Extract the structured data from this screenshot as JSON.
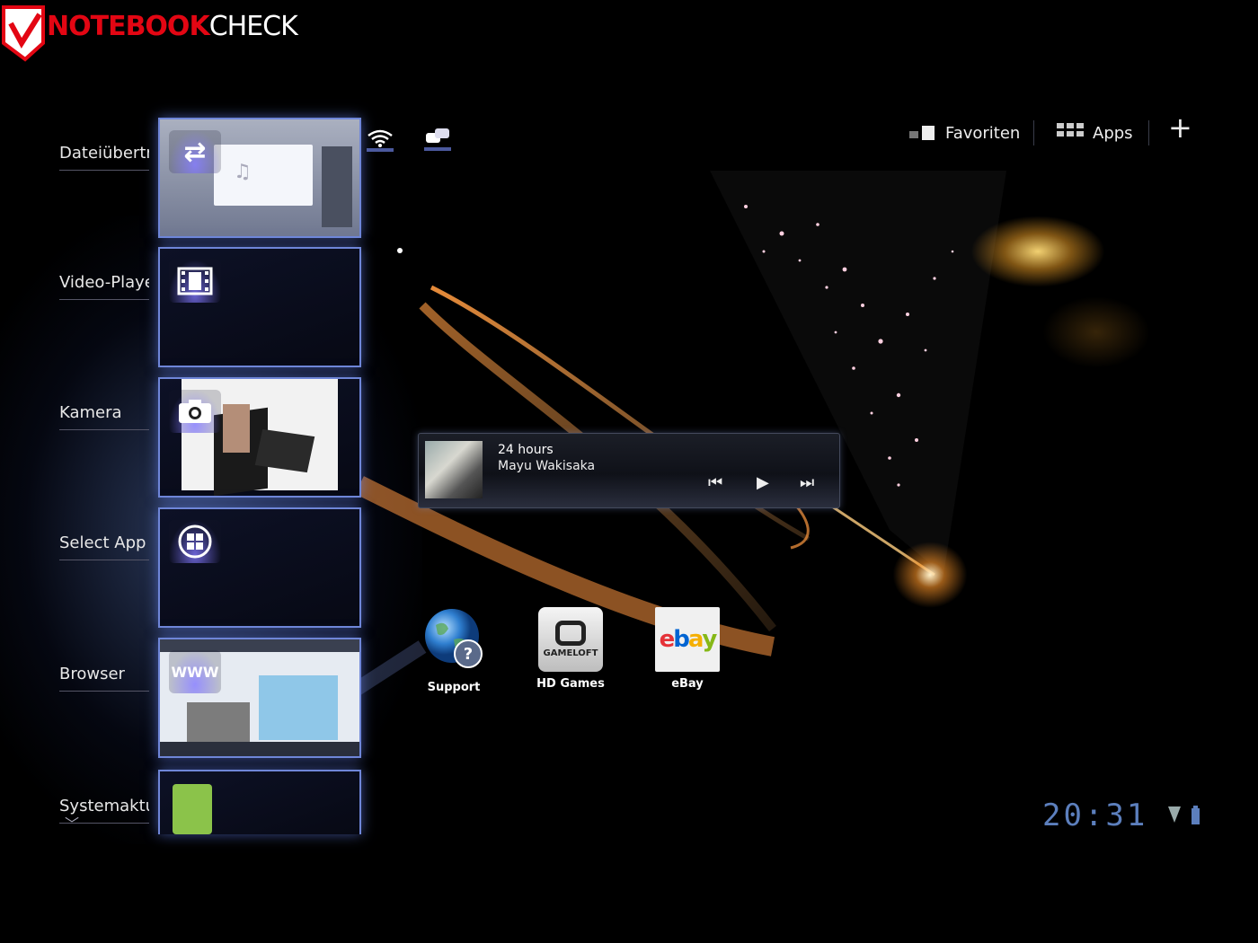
{
  "watermark": {
    "brand_red": "NOTEBOOK",
    "brand_white": "CHECK"
  },
  "recent_apps": [
    {
      "label": "Dateiübertr"
    },
    {
      "label": "Video-Playe"
    },
    {
      "label": "Kamera"
    },
    {
      "label": "Select App"
    },
    {
      "label": "Browser"
    },
    {
      "label": "Systemaktu"
    }
  ],
  "browser_icon_text": "WWW",
  "topbar": {
    "favorites_label": "Favoriten",
    "apps_label": "Apps",
    "add_label": "+"
  },
  "music_widget": {
    "song": "24 hours",
    "artist": "Mayu Wakisaka",
    "prev_icon": "⏮",
    "play_icon": "▶",
    "next_icon": "⏭"
  },
  "shortcuts": [
    {
      "label": "Support"
    },
    {
      "label": "HD Games",
      "logo_text": "GAMELOFT"
    },
    {
      "label": "eBay",
      "logo_text": "ebay"
    }
  ],
  "status": {
    "time": "20:31"
  },
  "colors": {
    "accent": "#6f86d8",
    "clock": "#5c7fbd",
    "brand_red": "#e30613"
  }
}
